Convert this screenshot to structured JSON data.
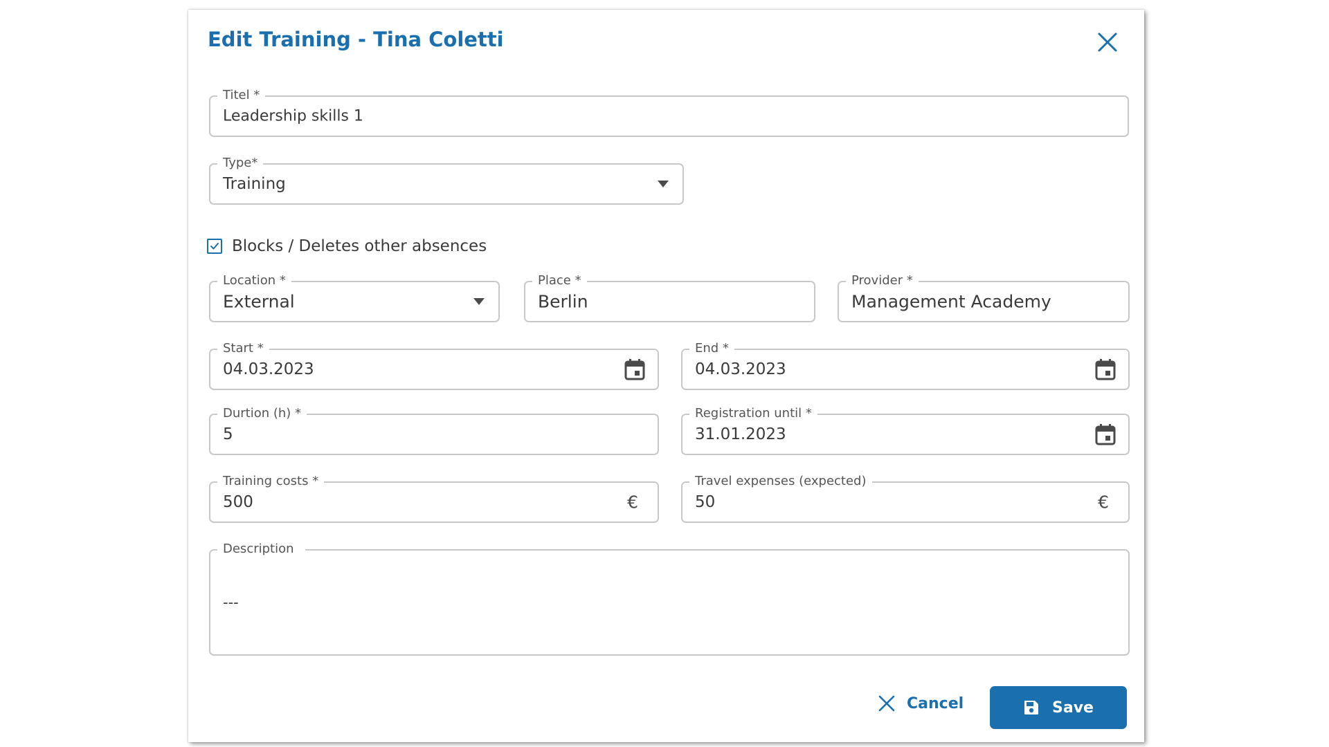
{
  "dialog": {
    "title": "Edit Training - Tina Coletti"
  },
  "form": {
    "titel": {
      "label": "Titel *",
      "value": "Leadership skills 1"
    },
    "type": {
      "label": "Type*",
      "value": "Training"
    },
    "blocks_checkbox": {
      "label": "Blocks / Deletes other absences",
      "checked": true
    },
    "location": {
      "label": "Location *",
      "value": "External"
    },
    "place": {
      "label": "Place *",
      "value": "Berlin"
    },
    "provider": {
      "label": "Provider *",
      "value": "Management Academy"
    },
    "start": {
      "label": "Start *",
      "value": "04.03.2023"
    },
    "end": {
      "label": "End *",
      "value": "04.03.2023"
    },
    "duration": {
      "label": "Durtion (h) *",
      "value": "5"
    },
    "registration_until": {
      "label": "Registration until *",
      "value": "31.01.2023"
    },
    "training_costs": {
      "label": "Training costs *",
      "value": "500",
      "currency": "€"
    },
    "travel_expenses": {
      "label": "Travel expenses (expected)",
      "value": "50",
      "currency": "€"
    },
    "description": {
      "label": "Description",
      "value": "---"
    }
  },
  "actions": {
    "cancel_label": "Cancel",
    "save_label": "Save"
  },
  "colors": {
    "accent": "#1a6faf",
    "border": "#c8c8c8",
    "text": "#3a3a3a"
  },
  "icons": {
    "close": "close-icon",
    "dropdown": "caret-down-icon",
    "calendar": "calendar-icon",
    "checkbox": "check-icon",
    "save": "floppy-disk-icon",
    "cancel": "x-icon"
  }
}
